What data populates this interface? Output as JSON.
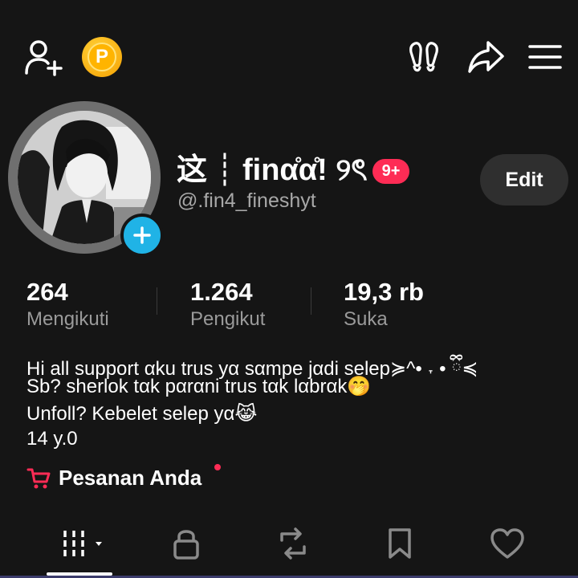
{
  "header": {
    "add_friend_icon": "person-plus-icon",
    "coin_label": "P",
    "footprints_icon": "footprints-icon",
    "share_icon": "share-arrow-icon",
    "menu_icon": "hamburger-menu-icon"
  },
  "profile": {
    "display_name": "这 ┊ finα̊α̊! ୨ৎ",
    "notification_badge": "9+",
    "username": "@.fin4_fineshyt",
    "edit_label": "Edit"
  },
  "stats": [
    {
      "value": "264",
      "label": "Mengikuti"
    },
    {
      "value": "1.264",
      "label": "Pengikut"
    },
    {
      "value": "19,3 rb",
      "label": "Suka"
    }
  ],
  "bio": {
    "line1": "Hi all support αku trus yα sαmpe jαdi selep≽^•  ˕  • ྀི≼",
    "line2": "Sb? sherlok tαk pαrαni trus tαk lαbrαk🤭",
    "line3": "Unfoll? Kebelet selep yα😹",
    "line4": "14 y.0"
  },
  "orders": {
    "label": "Pesanan Anda"
  },
  "tabs": [
    "videos-grid-tab",
    "private-lock-tab",
    "reposts-tab",
    "favorites-bookmark-tab",
    "liked-heart-tab"
  ],
  "colors": {
    "accent_red": "#fe2c55",
    "badge_blue": "#20b3e6",
    "coin_gold": "#ffb400",
    "background": "#151515"
  }
}
